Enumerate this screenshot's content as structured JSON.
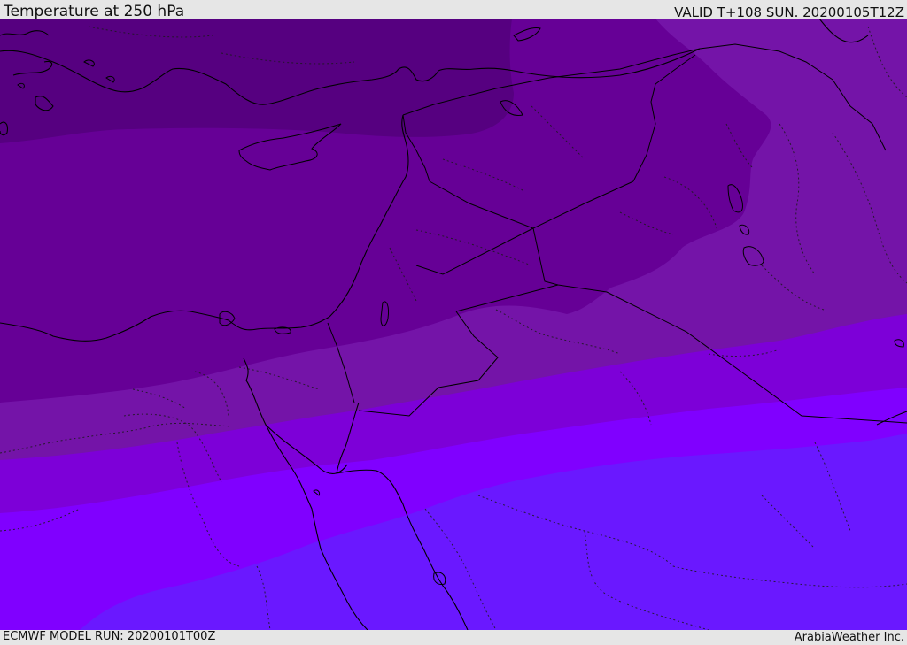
{
  "header": {
    "title": "Temperature at 250 hPa",
    "valid": "VALID T+108 SUN. 20200105T12Z"
  },
  "footer": {
    "model_run": "ECMWF MODEL RUN: 20200101T00Z",
    "credit": "ArabiaWeather Inc."
  },
  "palette": {
    "band_1": "#560080",
    "band_2": "#660096",
    "band_3": "#7414a8",
    "band_4": "#7d00d8",
    "band_5": "#8000ff",
    "band_6": "#6a18ff",
    "coastline": "#000000",
    "frame": "#e6e6e6"
  }
}
